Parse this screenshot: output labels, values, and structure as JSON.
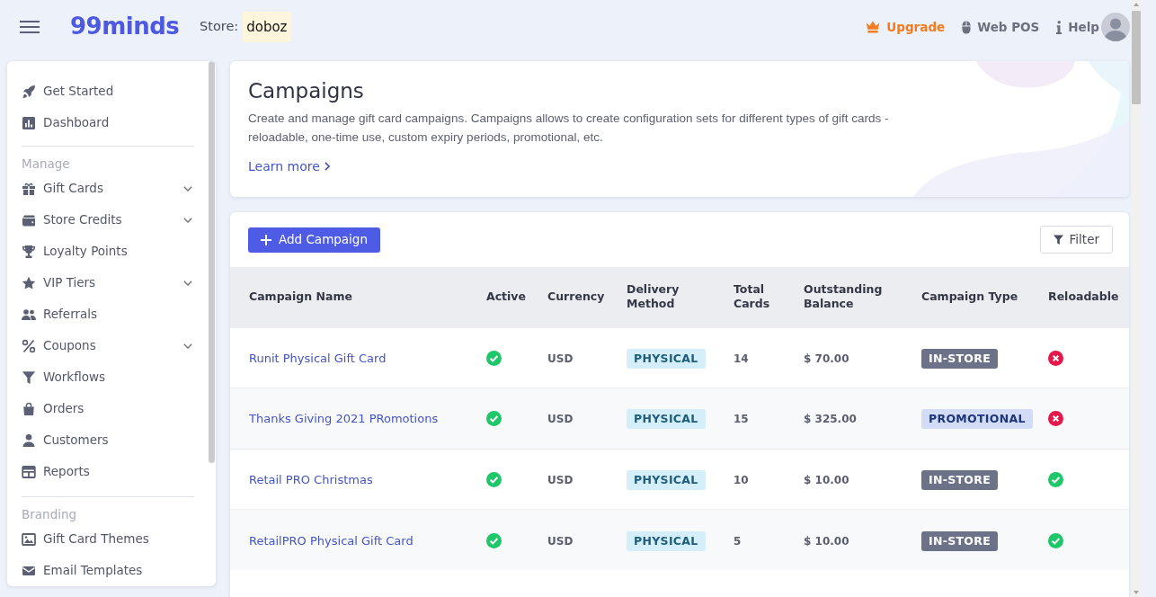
{
  "topbar": {
    "logo": "99minds",
    "store_label": "Store:",
    "store_name": "doboz",
    "actions": [
      {
        "label": "Upgrade",
        "kind": "upgrade"
      },
      {
        "label": "Web POS",
        "kind": "pos"
      },
      {
        "label": "Help",
        "kind": "help"
      }
    ]
  },
  "sidebar": {
    "sections": [
      {
        "items": [
          {
            "label": "Get Started",
            "submenu": false
          },
          {
            "label": "Dashboard",
            "submenu": false
          }
        ]
      },
      {
        "heading": "Manage",
        "items": [
          {
            "label": "Gift Cards",
            "submenu": true
          },
          {
            "label": "Store Credits",
            "submenu": true
          },
          {
            "label": "Loyalty Points",
            "submenu": false
          },
          {
            "label": "VIP Tiers",
            "submenu": true
          },
          {
            "label": "Referrals",
            "submenu": false
          },
          {
            "label": "Coupons",
            "submenu": true
          },
          {
            "label": "Workflows",
            "submenu": false
          },
          {
            "label": "Orders",
            "submenu": false
          },
          {
            "label": "Customers",
            "submenu": false
          },
          {
            "label": "Reports",
            "submenu": false
          }
        ]
      },
      {
        "heading": "Branding",
        "items": [
          {
            "label": "Gift Card Themes",
            "submenu": false
          },
          {
            "label": "Email Templates",
            "submenu": false
          }
        ]
      }
    ]
  },
  "header": {
    "title": "Campaigns",
    "description": "Create and manage gift card campaigns. Campaigns allows to create configuration sets for different types of gift cards - reloadable, one-time use, custom expiry periods, promotional, etc.",
    "link": "Learn more"
  },
  "toolbar": {
    "add_button": "Add Campaign",
    "filter_button": "Filter"
  },
  "table": {
    "columns": [
      "Campaign Name",
      "Active",
      "Currency",
      "Delivery Method",
      "Total Cards",
      "Outstanding Balance",
      "Campaign Type",
      "Reloadable"
    ],
    "rows": [
      {
        "name": "Runit Physical Gift Card",
        "active": true,
        "currency": "USD",
        "delivery_method": {
          "label": "PHYSICAL",
          "color": "#d4eefa"
        },
        "total_cards": "14",
        "outstanding_balance": "$ 70.00",
        "campaign_type": {
          "label": "IN-STORE",
          "color": "#6c7388"
        },
        "reloadable": false
      },
      {
        "name": "Thanks Giving 2021 PRomotions",
        "active": true,
        "currency": "USD",
        "delivery_method": {
          "label": "PHYSICAL",
          "color": "#d4eefa"
        },
        "total_cards": "15",
        "outstanding_balance": "$ 325.00",
        "campaign_type": {
          "label": "PROMOTIONAL",
          "color": "#d3dcf7"
        },
        "reloadable": false
      },
      {
        "name": "Retail PRO Christmas",
        "active": true,
        "currency": "USD",
        "delivery_method": {
          "label": "PHYSICAL",
          "color": "#d4eefa"
        },
        "total_cards": "10",
        "outstanding_balance": "$ 10.00",
        "campaign_type": {
          "label": "IN-STORE",
          "color": "#6c7388"
        },
        "reloadable": true
      },
      {
        "name": "RetailPRO Physical Gift Card",
        "active": true,
        "currency": "USD",
        "delivery_method": {
          "label": "PHYSICAL",
          "color": "#d4eefa"
        },
        "total_cards": "5",
        "outstanding_balance": "$ 10.00",
        "campaign_type": {
          "label": "IN-STORE",
          "color": "#6c7388"
        },
        "reloadable": true
      }
    ]
  }
}
